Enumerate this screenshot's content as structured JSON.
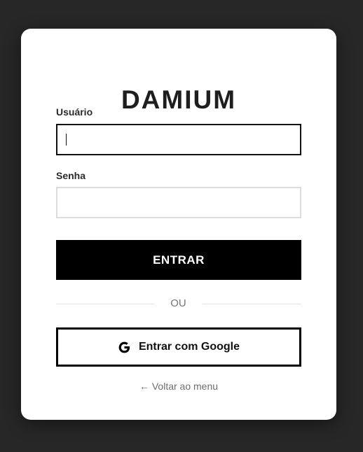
{
  "brand": {
    "title": "DAMIUM"
  },
  "form": {
    "username": {
      "label": "Usuário",
      "value": "",
      "placeholder": ""
    },
    "password": {
      "label": "Senha",
      "value": "",
      "placeholder": ""
    },
    "submit_label": "ENTRAR"
  },
  "divider": {
    "text": "OU"
  },
  "google": {
    "label": "Entrar com Google",
    "icon": "google-g-icon"
  },
  "back": {
    "label": "← Voltar ao menu"
  },
  "colors": {
    "background": "#272727",
    "card": "#ffffff",
    "primary": "#000000",
    "muted_text": "#777777"
  }
}
